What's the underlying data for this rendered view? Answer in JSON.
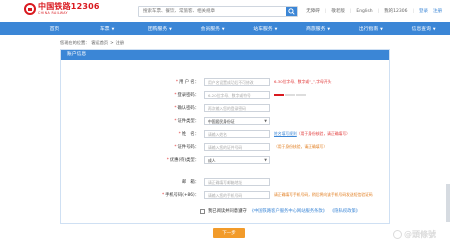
{
  "header": {
    "logo_title": "中国铁路12306",
    "logo_subtitle": "CHINA RAILWAY",
    "search_placeholder": "搜索车票、餐饮、常旅客、相关规章",
    "links": {
      "service": "无障碍",
      "care": "敬老版",
      "language": "English",
      "my12306": "我的12306",
      "login": "登录",
      "register": "注册"
    }
  },
  "nav": [
    {
      "label": "首页"
    },
    {
      "label": "车票"
    },
    {
      "label": "团购服务"
    },
    {
      "label": "会员服务"
    },
    {
      "label": "站车服务"
    },
    {
      "label": "商旅服务"
    },
    {
      "label": "出行指南"
    },
    {
      "label": "信息查询"
    }
  ],
  "breadcrumb": {
    "prefix": "您现在的位置：",
    "home": "客运首页",
    "sep": ">",
    "current": "注册"
  },
  "panel": {
    "title": "账户信息"
  },
  "form": {
    "username": {
      "label": "用 户 名：",
      "placeholder": "用户名设置成功后不可修改",
      "hint": "6-30位字母、数字或“_”,字母开头"
    },
    "password": {
      "label": "登录密码：",
      "placeholder": "6-20位字母、数字或符号"
    },
    "confirm": {
      "label": "确认密码：",
      "placeholder": "再次输入您的登录密码"
    },
    "id_type": {
      "label": "证件类型：",
      "value": "中国居民身份证"
    },
    "name": {
      "label": "姓　名：",
      "placeholder": "请输入姓名",
      "hint_link": "姓名填写规则",
      "hint_note": "（用于身份核验，请正确填写）"
    },
    "id_number": {
      "label": "证件号码：",
      "placeholder": "请输入您的证件号码",
      "hint": "（用于身份核验，请正确填写）"
    },
    "passenger_type": {
      "label": "优惠(待)类型：",
      "value": "成人"
    },
    "email": {
      "label": "邮　箱：",
      "placeholder": "请正确填写邮箱地址"
    },
    "phone": {
      "label": "手机号码(+86)：",
      "placeholder": "请输入您的手机号码",
      "hint": "请正确填写手机号码，稍后将向该手机号码发送短信验证码"
    },
    "agree": {
      "text": "我已阅读并同意遵守",
      "link_terms": "《中国铁路客户服务中心网站服务条款》",
      "link_privacy": "《隐私权政策》"
    }
  },
  "next_button": "下一步",
  "watermark": "@頭條號"
}
